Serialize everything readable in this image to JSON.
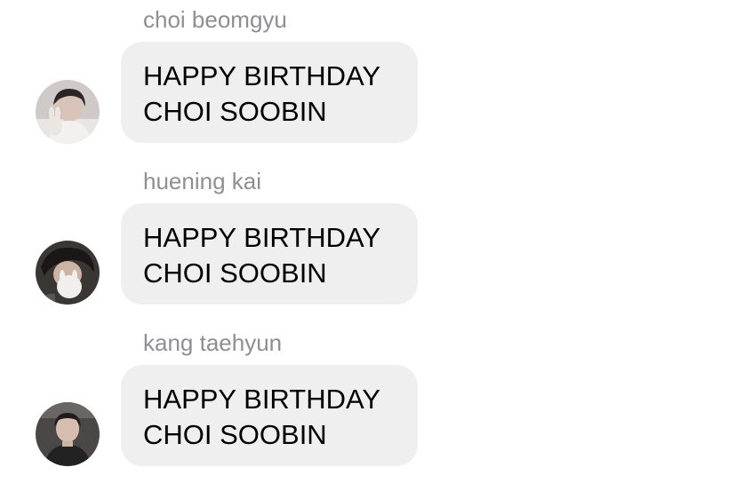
{
  "messages": [
    {
      "sender": "choi beomgyu",
      "avatar_icon": "profile-avatar",
      "lines": [
        "HAPPY BIRTHDAY",
        "CHOI SOOBIN"
      ]
    },
    {
      "sender": "huening kai",
      "avatar_icon": "profile-avatar",
      "lines": [
        "HAPPY BIRTHDAY",
        "CHOI SOOBIN"
      ]
    },
    {
      "sender": "kang taehyun",
      "avatar_icon": "profile-avatar",
      "lines": [
        "HAPPY BIRTHDAY",
        "CHOI SOOBIN"
      ]
    }
  ],
  "colors": {
    "bubble_bg": "#efefef",
    "sender_text": "#8e8e93",
    "message_text": "#000000"
  }
}
